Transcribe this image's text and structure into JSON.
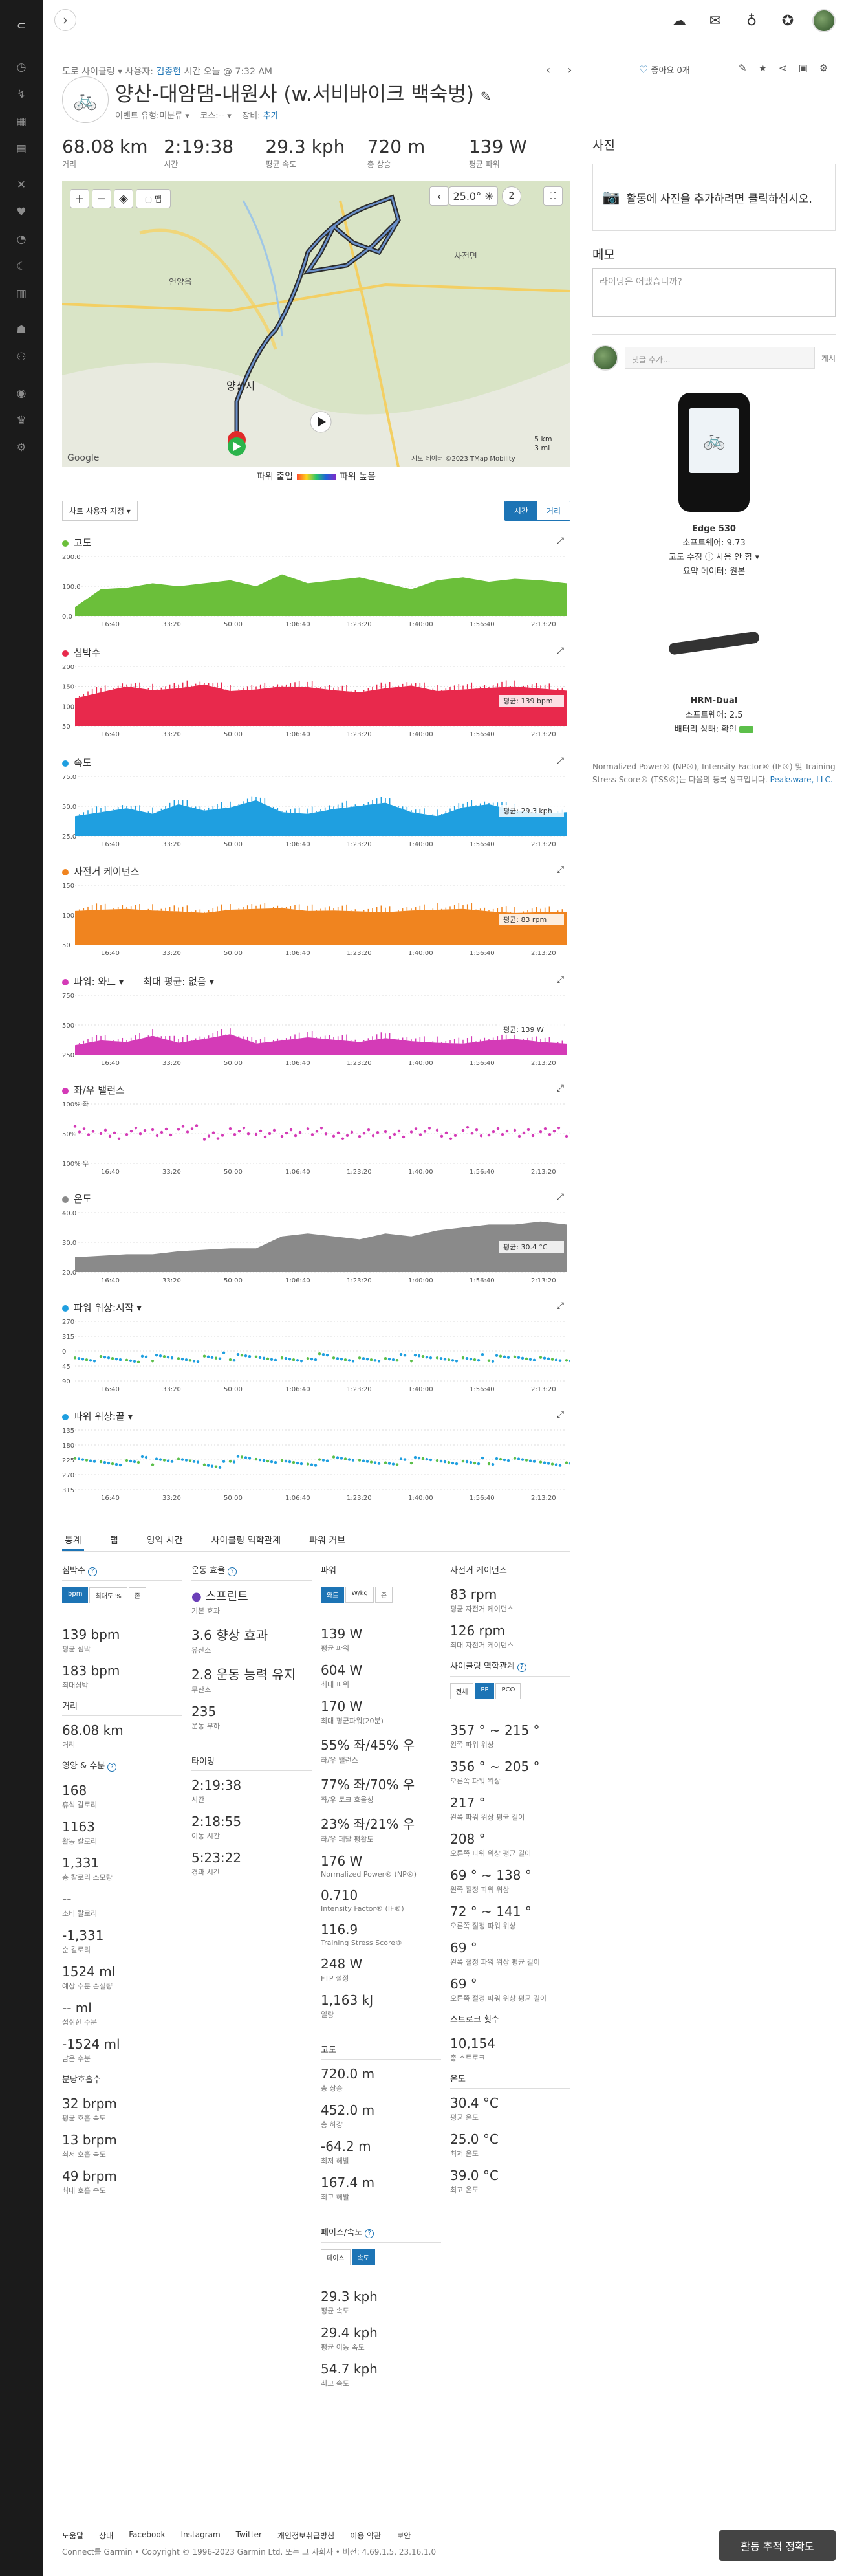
{
  "activity": {
    "breadcrumb_prefix": "도로 사이클링 ▾  사용자:",
    "user": "김종현",
    "time_text": "시간 오늘 @ 7:32 AM",
    "title": "양산-대암댐-내원사 (w.서비바이크 백숙벙)",
    "sub_event": "이벤트 유형:미분류 ▾",
    "sub_course": "코스:-- ▾",
    "sub_gear": "장비:",
    "sub_gear_link": "추가",
    "like_text": "좋아요 0개"
  },
  "stats": [
    {
      "value": "68.08 km",
      "label": "거리"
    },
    {
      "value": "2:19:38",
      "label": "시간"
    },
    {
      "value": "29.3 kph",
      "label": "평균 속도"
    },
    {
      "value": "720 m",
      "label": "총 상승"
    },
    {
      "value": "139 W",
      "label": "평균 파워"
    }
  ],
  "map": {
    "temp": "25.0°",
    "weather_num": "2",
    "scale_km": "5 km",
    "scale_mi": "3 mi",
    "legend_left": "파워 출입",
    "legend_right": "파워 높음",
    "attribution": "지도 데이터 ©2023 TMap Mobility",
    "google": "Google",
    "labels": [
      "양산시",
      "언양읍",
      "사전면"
    ],
    "layer_btn": "▢ 맵"
  },
  "chart_opts": {
    "dropdown": "차트 사용자 지정 ▾",
    "toggle": [
      "시간",
      "거리"
    ]
  },
  "charts": [
    {
      "key": "elev",
      "title": "고도",
      "color": "#6bbf3a",
      "ticks": [
        "200.0",
        "100.0",
        "0.0"
      ],
      "label": "",
      "type": "area",
      "chart_data": {
        "type": "area",
        "x_ticks": [
          "16:40",
          "33:20",
          "50:00",
          "1:06:40",
          "1:23:20",
          "1:40:00",
          "1:56:40",
          "2:13:20"
        ],
        "ylim": [
          0,
          200
        ],
        "values": [
          30,
          90,
          95,
          110,
          100,
          110,
          120,
          100,
          140,
          110,
          120,
          130,
          110,
          90,
          120,
          130,
          115,
          125,
          120,
          110
        ]
      }
    },
    {
      "key": "hr",
      "title": "심박수",
      "color": "#e8294c",
      "ticks": [
        "200",
        "150",
        "100",
        "50"
      ],
      "label": "평균: 139 bpm",
      "type": "area",
      "chart_data": {
        "type": "area",
        "ylim": [
          50,
          200
        ],
        "values": [
          120,
          135,
          150,
          140,
          145,
          155,
          138,
          142,
          150,
          148,
          140,
          135,
          145,
          152,
          138,
          142,
          146,
          150,
          144,
          139
        ]
      }
    },
    {
      "key": "speed",
      "title": "속도",
      "color": "#1f9fe0",
      "ticks": [
        "75.0",
        "50.0",
        "25.0"
      ],
      "label": "평균: 29.3 kph",
      "type": "area",
      "chart_data": {
        "type": "area",
        "ylim": [
          0,
          75
        ],
        "values": [
          25,
          30,
          35,
          28,
          40,
          32,
          36,
          45,
          30,
          28,
          34,
          38,
          42,
          30,
          25,
          36,
          40,
          32,
          28,
          30
        ]
      }
    },
    {
      "key": "cad",
      "title": "자전거 케이던스",
      "color": "#f0841f",
      "ticks": [
        "150",
        "100",
        "50"
      ],
      "label": "평균: 83 rpm",
      "type": "area",
      "chart_data": {
        "type": "area",
        "ylim": [
          0,
          150
        ],
        "values": [
          85,
          88,
          90,
          86,
          84,
          80,
          88,
          90,
          92,
          85,
          86,
          84,
          82,
          86,
          88,
          90,
          84,
          80,
          82,
          83
        ]
      }
    },
    {
      "key": "power",
      "title": "파워: 와트 ▾",
      "color": "#d43bb7",
      "ticks": [
        "750",
        "500",
        "250"
      ],
      "label": "평균: 139 W",
      "type": "area",
      "extra": "최대 평균: 없음 ▾",
      "chart_data": {
        "type": "area",
        "ylim": [
          0,
          750
        ],
        "values": [
          120,
          180,
          160,
          240,
          150,
          200,
          260,
          140,
          180,
          220,
          190,
          160,
          210,
          170,
          150,
          140,
          180,
          200,
          160,
          139
        ]
      }
    },
    {
      "key": "bal",
      "title": "좌/우 밸런스",
      "color": "#d43bb7",
      "ticks": [
        "100% 좌",
        "50%",
        "100% 우"
      ],
      "label": "",
      "type": "scatter",
      "chart_data": {
        "type": "scatter",
        "ylim": [
          0,
          100
        ],
        "values": [
          55,
          48,
          52,
          50,
          56,
          45,
          53,
          49,
          51,
          54,
          47,
          52,
          50,
          55,
          48,
          53,
          51,
          49,
          52,
          50
        ]
      }
    },
    {
      "key": "temp",
      "title": "온도",
      "color": "#8a8a8a",
      "ticks": [
        "40.0",
        "30.0",
        "20.0"
      ],
      "label": "평균: 30.4 °C",
      "type": "area",
      "chart_data": {
        "type": "area",
        "ylim": [
          20,
          40
        ],
        "values": [
          25,
          25.5,
          26,
          26,
          27,
          27.5,
          28,
          28,
          32,
          33,
          32,
          31,
          33,
          32,
          34,
          35,
          36,
          36,
          37,
          36
        ]
      }
    },
    {
      "key": "pps",
      "title": "파워 위상:시작 ▾",
      "color": "#1f9fe0",
      "ticks": [
        "270",
        "315",
        "0",
        "45",
        "90"
      ],
      "label": "",
      "type": "band",
      "chart_data": {
        "type": "scatter",
        "ylim": [
          90,
          270
        ],
        "values": [
          150,
          160,
          155,
          158,
          152,
          165,
          160,
          155,
          158,
          162,
          150,
          156,
          160,
          158,
          154,
          160,
          157,
          155,
          159,
          156
        ]
      }
    },
    {
      "key": "ppe",
      "title": "파워 위상:끝 ▾",
      "color": "#1f9fe0",
      "ticks": [
        "135",
        "180",
        "225",
        "270",
        "315"
      ],
      "label": "",
      "type": "band",
      "chart_data": {
        "type": "scatter",
        "ylim": [
          135,
          315
        ],
        "values": [
          220,
          215,
          225,
          218,
          222,
          210,
          226,
          219,
          221,
          216,
          224,
          220,
          218,
          223,
          217,
          221,
          219,
          222,
          216,
          220
        ]
      }
    }
  ],
  "x_ticks": [
    "16:40",
    "33:20",
    "50:00",
    "1:06:40",
    "1:23:20",
    "1:40:00",
    "1:56:40",
    "2:13:20"
  ],
  "tabs": [
    "통계",
    "랩",
    "영역 시간",
    "사이클링 역학관계",
    "파워 커브"
  ],
  "col1": {
    "hr_title": "심박수",
    "hr_seg": [
      "bpm",
      "최대도 %",
      "존"
    ],
    "metrics": [
      {
        "v": "139 bpm",
        "l": "평균 심박"
      },
      {
        "v": "183 bpm",
        "l": "최대심박"
      }
    ],
    "dist_title": "거리",
    "dist": [
      {
        "v": "68.08 km",
        "l": "거리"
      }
    ],
    "nut_title": "영양 & 수분",
    "nut": [
      {
        "v": "168",
        "l": "휴식 칼로리"
      },
      {
        "v": "1163",
        "l": "활동 칼로리"
      },
      {
        "v": "1,331",
        "l": "총 칼로리 소모량"
      },
      {
        "v": "--",
        "l": "소비 칼로리"
      },
      {
        "v": "-1,331",
        "l": "순 칼로리"
      },
      {
        "v": "1524 ml",
        "l": "예상 수분 손실량"
      },
      {
        "v": "-- ml",
        "l": "섭취한 수분"
      },
      {
        "v": "-1524 ml",
        "l": "남은 수분"
      }
    ],
    "resp_title": "분당호흡수",
    "resp": [
      {
        "v": "32 brpm",
        "l": "평균 호흡 속도"
      },
      {
        "v": "13 brpm",
        "l": "최저 호흡 속도"
      },
      {
        "v": "49 brpm",
        "l": "최대 호흡 속도"
      }
    ]
  },
  "col2": {
    "te_title": "운동 효율",
    "te_label": "스프린트",
    "te_sub": "기본 효과",
    "te": [
      {
        "v": "3.6 향상 효과",
        "l": "유산소"
      },
      {
        "v": "2.8 운동 능력 유지",
        "l": "무산소"
      },
      {
        "v": "235",
        "l": "운동 부하"
      }
    ],
    "timing_title": "타이밍",
    "timing": [
      {
        "v": "2:19:38",
        "l": "시간"
      },
      {
        "v": "2:18:55",
        "l": "이동 시간"
      },
      {
        "v": "5:23:22",
        "l": "경과 시간"
      }
    ]
  },
  "col3": {
    "power_title": "파워",
    "power_seg": [
      "와트",
      "W/kg",
      "존"
    ],
    "power": [
      {
        "v": "139 W",
        "l": "평균 파워"
      },
      {
        "v": "604 W",
        "l": "최대 파워"
      },
      {
        "v": "170 W",
        "l": "최대 평균파워(20분)"
      },
      {
        "v": "55% 좌/45% 우",
        "l": "좌/우 밸런스"
      },
      {
        "v": "77% 좌/70% 우",
        "l": "좌/우 토크 효율성"
      },
      {
        "v": "23% 좌/21% 우",
        "l": "좌/우 페달 평활도"
      },
      {
        "v": "176 W",
        "l": "Normalized Power® (NP®)"
      },
      {
        "v": "0.710",
        "l": "Intensity Factor® (IF®)"
      },
      {
        "v": "116.9",
        "l": "Training Stress Score®"
      },
      {
        "v": "248 W",
        "l": "FTP 설정"
      },
      {
        "v": "1,163 kJ",
        "l": "일량"
      }
    ],
    "elev_title": "고도",
    "elev": [
      {
        "v": "720.0 m",
        "l": "총 상승"
      },
      {
        "v": "452.0 m",
        "l": "총 하강"
      },
      {
        "v": "-64.2 m",
        "l": "최저 해발"
      },
      {
        "v": "167.4 m",
        "l": "최고 해발"
      }
    ],
    "pace_title": "페이스/속도",
    "pace_seg": [
      "페이스",
      "속도"
    ],
    "pace": [
      {
        "v": "29.3 kph",
        "l": "평균 속도"
      },
      {
        "v": "29.4 kph",
        "l": "평균 이동 속도"
      },
      {
        "v": "54.7 kph",
        "l": "최고 속도"
      }
    ]
  },
  "col4": {
    "cad_title": "자전거 케이던스",
    "cad": [
      {
        "v": "83 rpm",
        "l": "평균 자전거 케이던스"
      },
      {
        "v": "126 rpm",
        "l": "최대 자전거 케이던스"
      }
    ],
    "dyn_title": "사이클링 역학관계",
    "dyn_seg": [
      "전체",
      "PP",
      "PCO"
    ],
    "dyn": [
      {
        "v": "357 ° ~ 215 °",
        "l": "왼쪽 파워 위상"
      },
      {
        "v": "356 ° ~ 205 °",
        "l": "오른쪽 파워 위상"
      },
      {
        "v": "217 °",
        "l": "왼쪽 파워 위상 평균 길이"
      },
      {
        "v": "208 °",
        "l": "오른쪽 파워 위상 평균 길이"
      },
      {
        "v": "69 ° ~ 138 °",
        "l": "왼쪽 절정 파워 위상"
      },
      {
        "v": "72 ° ~ 141 °",
        "l": "오른쪽 절정 파워 위상"
      },
      {
        "v": "69 °",
        "l": "왼쪽 절정 파워 위상 평균 길이"
      },
      {
        "v": "69 °",
        "l": "오른쪽 절정 파워 위상 평균 길이"
      }
    ],
    "stroke_title": "스트로크 횟수",
    "stroke": [
      {
        "v": "10,154",
        "l": "총 스트로크"
      }
    ],
    "temp_title": "온도",
    "temp": [
      {
        "v": "30.4 °C",
        "l": "평균 온도"
      },
      {
        "v": "25.0 °C",
        "l": "최저 온도"
      },
      {
        "v": "39.0 °C",
        "l": "최고 온도"
      }
    ]
  },
  "right": {
    "photo_title": "사진",
    "photo_text": "활동에 사진을 추가하려면 클릭하십시오.",
    "note_title": "메모",
    "note_placeholder": "라이딩은 어땠습니까?",
    "comment_placeholder": "댓글 추가...",
    "comment_btn": "게시",
    "dev1_name": "Edge 530",
    "dev1_sw": "소프트웨어: 9.73",
    "dev1_elev": "고도 수정 ⓘ 사용 안 함 ▾",
    "dev1_sum": "요약 데이터: 원본",
    "dev2_name": "HRM-Dual",
    "dev2_sw": "소프트웨어: 2.5",
    "dev2_bat": "배터리 상태: 확인",
    "legal": "Normalized Power® (NP®), Intensity Factor® (IF®) 및 Training Stress Score® (TSS®)는 다음의 등록 상표입니다.",
    "legal_link": "Peaksware, LLC."
  },
  "footer": {
    "links": [
      "도움말",
      "상태",
      "Facebook",
      "Instagram",
      "Twitter",
      "개인정보취급방침",
      "이용 약관",
      "보안"
    ],
    "copy": "Connect를 Garmin • Copyright © 1996-2023 Garmin Ltd. 또는 그 자회사 • 버전: 4.69.1.5, 23.16.1.0",
    "accuracy_btn": "활동 추적 정확도"
  },
  "colors": {
    "accent": "#1d74b5",
    "sidebar": "#1b1b1b"
  }
}
